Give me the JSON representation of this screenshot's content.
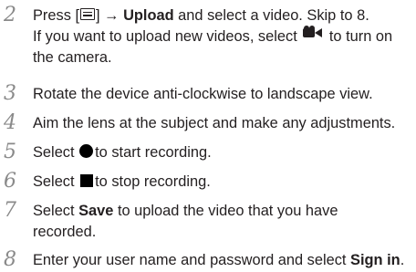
{
  "steps": [
    {
      "number": "2",
      "line1_pre": "Press [",
      "line1_mid": "] → ",
      "line1_bold": "Upload",
      "line1_post": " and select a video. Skip to 8.",
      "line2_pre": "If you want to upload new videos, select ",
      "line2_post": " to turn on",
      "line3": "the camera."
    },
    {
      "number": "3",
      "text": "Rotate the device anti-clockwise to landscape view."
    },
    {
      "number": "4",
      "text": "Aim the lens at the subject and make any adjustments."
    },
    {
      "number": "5",
      "pre": "Select ",
      "post": "to start recording."
    },
    {
      "number": "6",
      "pre": "Select ",
      "post": "to stop recording."
    },
    {
      "number": "7",
      "pre": "Select ",
      "bold": "Save",
      "post": " to upload the video that you have",
      "line2": "recorded."
    },
    {
      "number": "8",
      "pre": "Enter your user name and password and select ",
      "bold": "Sign in",
      "post": "."
    }
  ],
  "icons": {
    "menu_key": "menu-key-icon",
    "video_camera": "video-camera-icon",
    "record": "record-circle-icon",
    "stop": "stop-square-icon"
  }
}
